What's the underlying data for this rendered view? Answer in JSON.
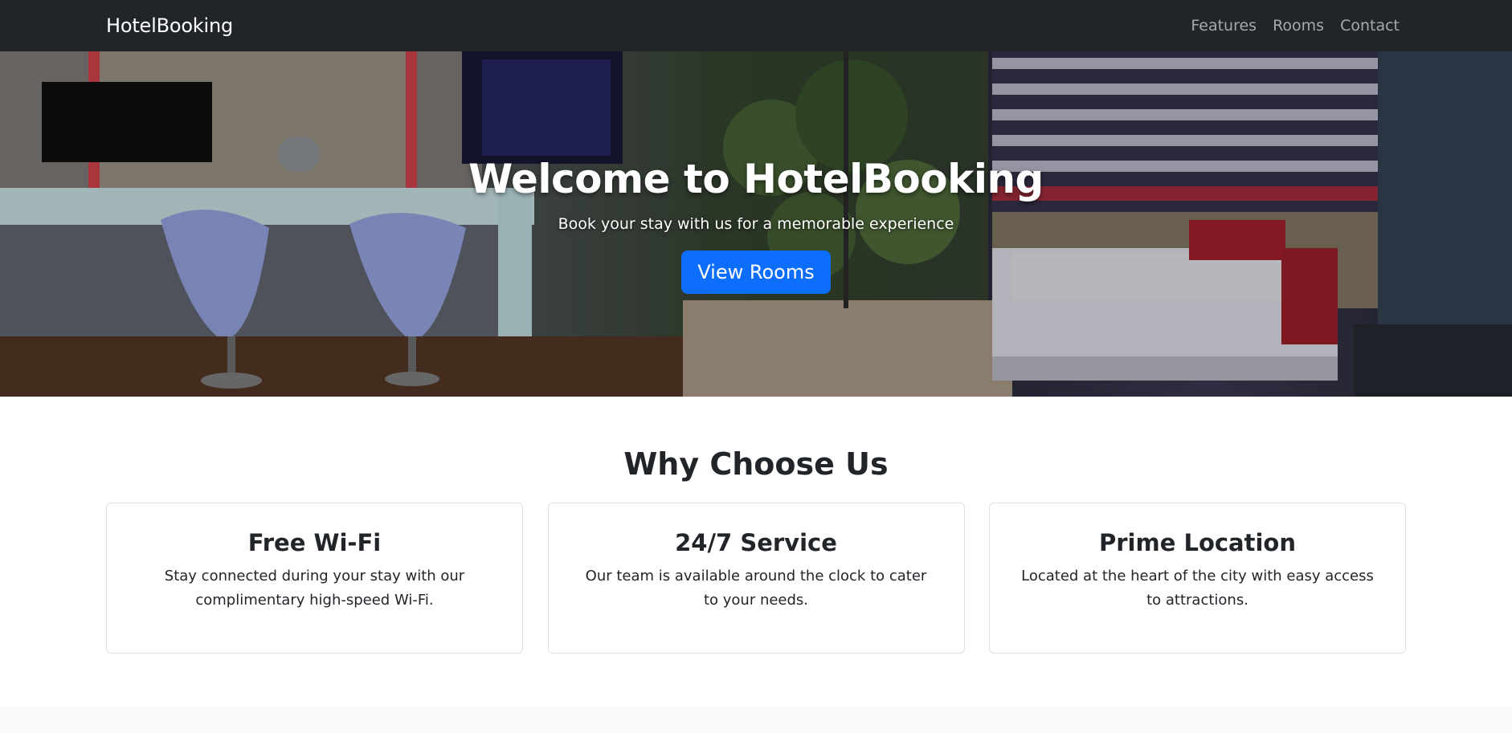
{
  "navbar": {
    "brand": "HotelBooking",
    "links": [
      "Features",
      "Rooms",
      "Contact"
    ]
  },
  "hero": {
    "title": "Welcome to HotelBooking",
    "subtitle": "Book your stay with us for a memorable experience",
    "button_label": "View Rooms"
  },
  "features": {
    "title": "Why Choose Us",
    "cards": [
      {
        "title": "Free Wi-Fi",
        "text": "Stay connected during your stay with our complimentary high-speed Wi-Fi."
      },
      {
        "title": "24/7 Service",
        "text": "Our team is available around the clock to cater to your needs."
      },
      {
        "title": "Prime Location",
        "text": "Located at the heart of the city with easy access to attractions."
      }
    ]
  },
  "colors": {
    "navbar_bg": "#212529",
    "primary_button": "#0d6efd",
    "card_border": "#dee2e6"
  }
}
